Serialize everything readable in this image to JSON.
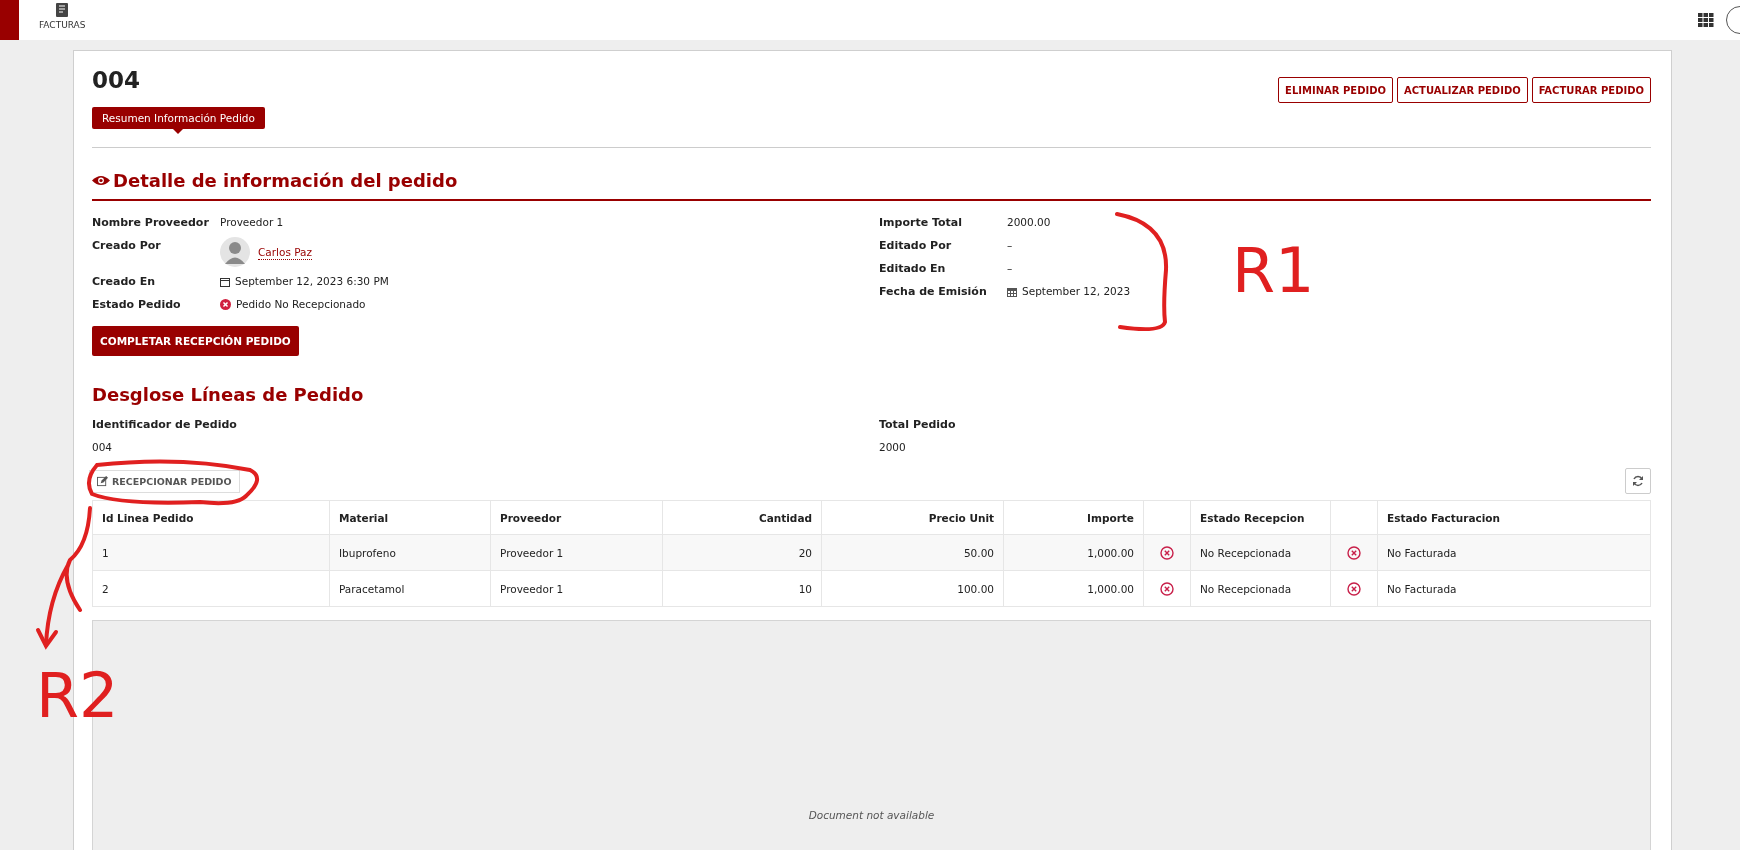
{
  "topbar": {
    "module": "FACTURAS"
  },
  "order": {
    "title": "004",
    "actions": [
      "ELIMINAR PEDIDO",
      "ACTUALIZAR PEDIDO",
      "FACTURAR PEDIDO"
    ],
    "tab": {
      "label": "Resumen Información Pedido",
      "selected": true
    }
  },
  "detail": {
    "heading": "Detalle de información del pedido",
    "left": [
      {
        "label": "Nombre Proveedor",
        "kind": "text",
        "value": "Proveedor 1"
      },
      {
        "label": "Creado Por",
        "kind": "user",
        "value": "Carlos Paz"
      },
      {
        "label": "Creado En",
        "kind": "datetime",
        "value": "September 12, 2023 6:30 PM"
      },
      {
        "label": "Estado Pedido",
        "kind": "status",
        "value": "Pedido No Recepcionado"
      }
    ],
    "right": [
      {
        "label": "Importe Total",
        "kind": "text",
        "value": "2000.00"
      },
      {
        "label": "Editado Por",
        "kind": "text",
        "value": "–"
      },
      {
        "label": "Editado En",
        "kind": "text",
        "value": "–"
      },
      {
        "label": "Fecha de Emisión",
        "kind": "date",
        "value": "September 12, 2023"
      }
    ],
    "complete_button": "COMPLETAR RECEPCIÓN PEDIDO"
  },
  "lines": {
    "heading": "Desglose Líneas de Pedido",
    "summary": [
      {
        "label": "Identificador de Pedido",
        "value": "004"
      },
      {
        "label": "Total Pedido",
        "value": "2000"
      }
    ],
    "receive_button": "RECEPCIONAR PEDIDO",
    "columns": [
      {
        "label": "Id Linea Pedido",
        "kind": "text"
      },
      {
        "label": "Material",
        "kind": "text"
      },
      {
        "label": "Proveedor",
        "kind": "text"
      },
      {
        "label": "Cantidad",
        "kind": "number"
      },
      {
        "label": "Precio Unit",
        "kind": "number"
      },
      {
        "label": "Importe",
        "kind": "number"
      },
      {
        "label": "Estado Recepcion",
        "kind": "status"
      },
      {
        "label": "Estado Facturacion",
        "kind": "status"
      }
    ],
    "rows": [
      {
        "cells": [
          "1",
          "Ibuprofeno",
          "Proveedor 1",
          "20",
          "50.00",
          "1,000.00",
          "No Recepcionada",
          "No Facturada"
        ],
        "received": false,
        "invoiced": false
      },
      {
        "cells": [
          "2",
          "Paracetamol",
          "Proveedor 1",
          "10",
          "100.00",
          "1,000.00",
          "No Recepcionada",
          "No Facturada"
        ],
        "invoiced": false,
        "received": false
      }
    ]
  },
  "document": {
    "message": "Document not available"
  },
  "annotations": [
    {
      "label": "R1"
    },
    {
      "label": "R2"
    }
  ]
}
